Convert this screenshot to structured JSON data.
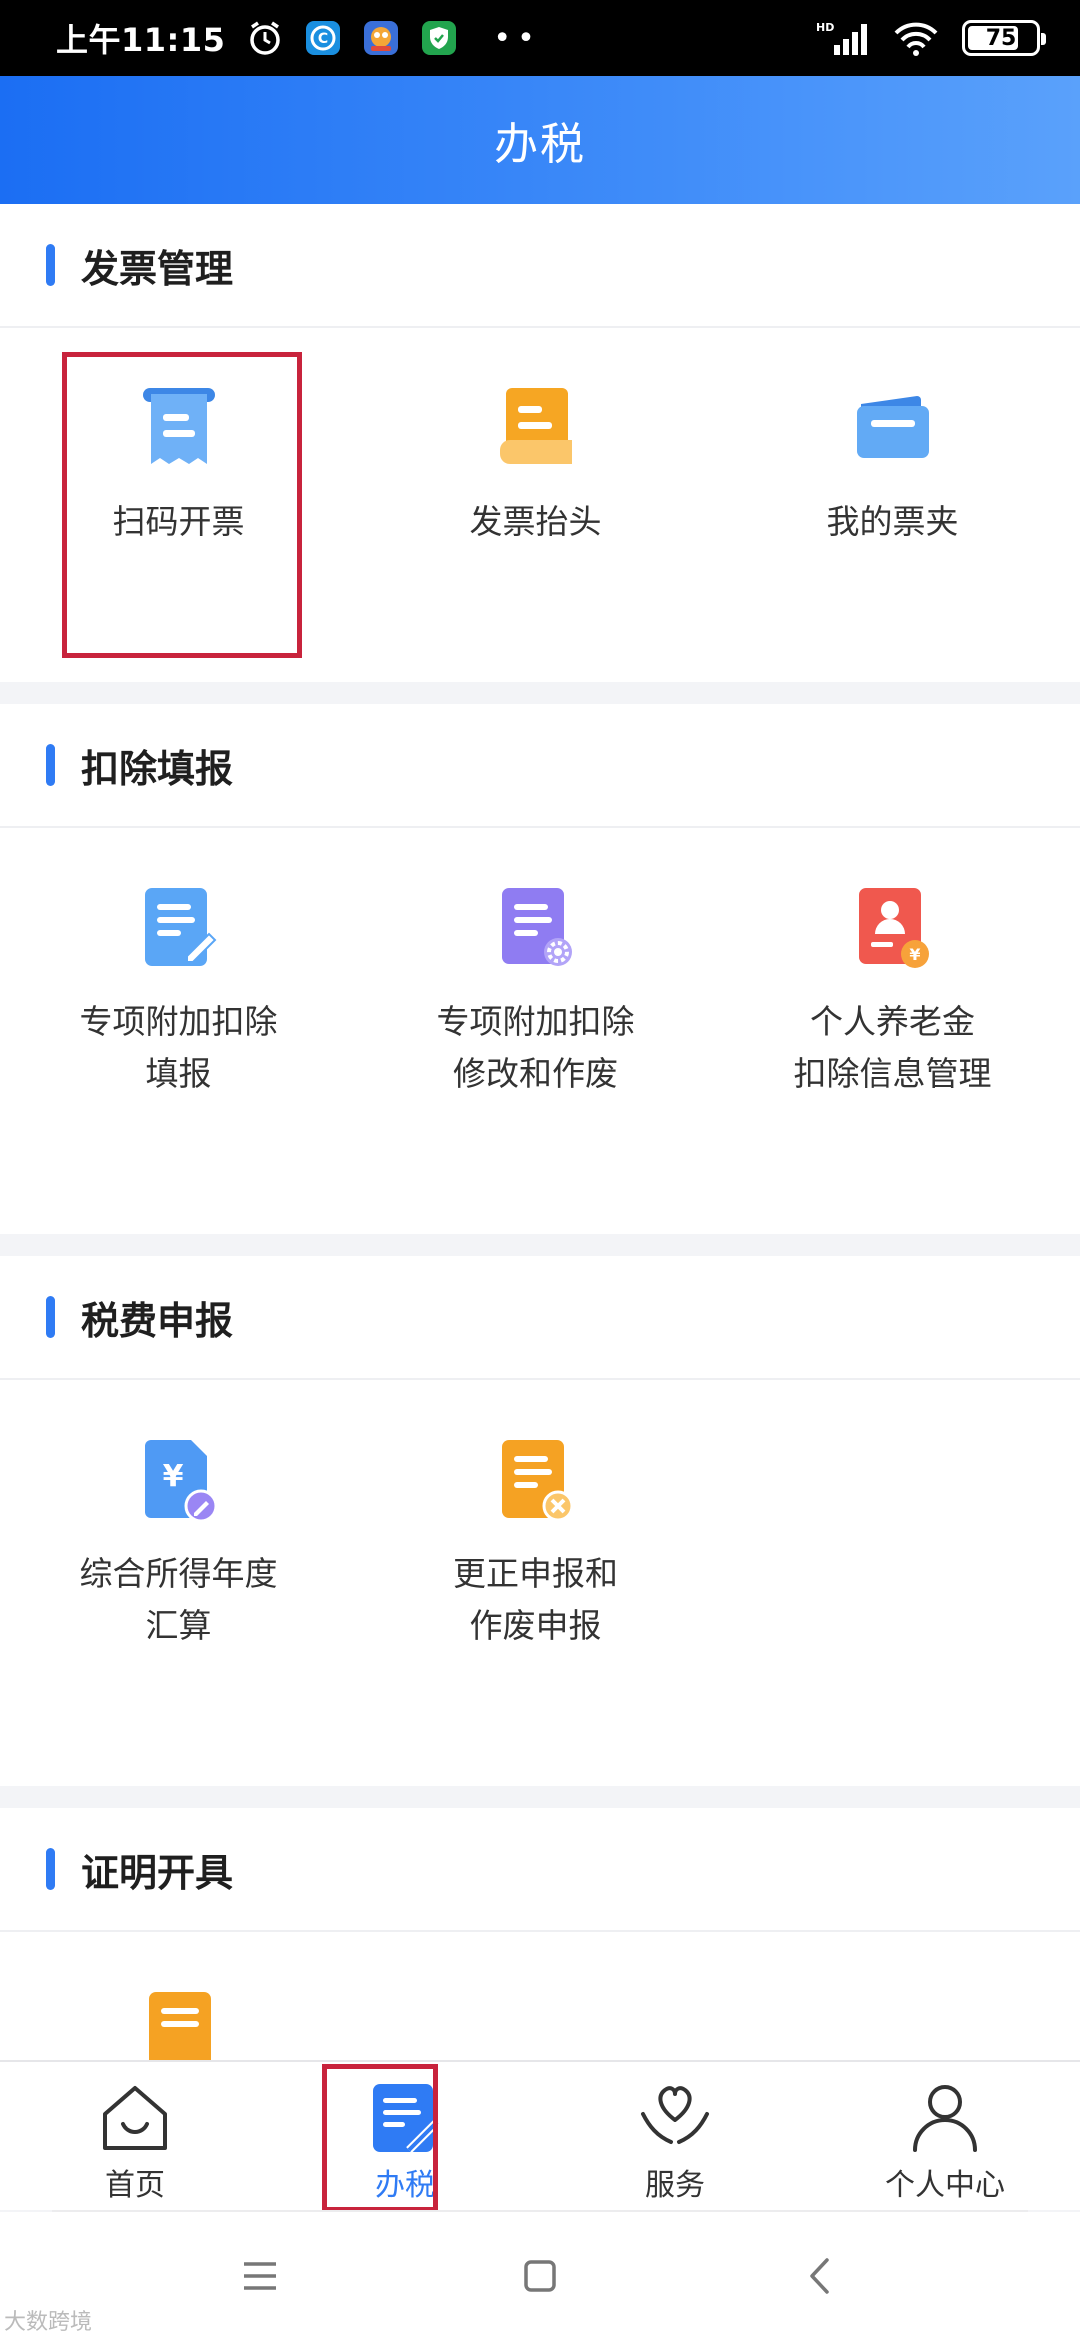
{
  "status_bar": {
    "time": "上午11:15",
    "network": "HD",
    "battery": "75",
    "battery_level": 0.75
  },
  "header": {
    "title": "办税"
  },
  "sections": [
    {
      "title": "发票管理",
      "items": [
        {
          "label": "扫码开票",
          "icon": "receipt-icon"
        },
        {
          "label": "发票抬头",
          "icon": "invoice-header-icon"
        },
        {
          "label": "我的票夹",
          "icon": "wallet-icon"
        }
      ]
    },
    {
      "title": "扣除填报",
      "items": [
        {
          "label": "专项附加扣除\n填报",
          "icon": "document-edit-icon"
        },
        {
          "label": "专项附加扣除\n修改和作废",
          "icon": "document-settings-icon"
        },
        {
          "label": "个人养老金\n扣除信息管理",
          "icon": "pension-card-icon"
        }
      ]
    },
    {
      "title": "税费申报",
      "items": [
        {
          "label": "综合所得年度\n汇算",
          "icon": "yuan-document-icon"
        },
        {
          "label": "更正申报和\n作废申报",
          "icon": "document-cancel-icon"
        }
      ]
    },
    {
      "title": "证明开具",
      "items": [
        {
          "label": "",
          "icon": "certificate-icon"
        }
      ]
    }
  ],
  "bottom_nav": [
    {
      "label": "首页",
      "icon": "home-icon",
      "active": false
    },
    {
      "label": "办税",
      "icon": "tax-document-icon",
      "active": true
    },
    {
      "label": "服务",
      "icon": "heart-hands-icon",
      "active": false
    },
    {
      "label": "个人中心",
      "icon": "person-icon",
      "active": false
    }
  ],
  "system_nav": [
    "menu-icon",
    "home-square-icon",
    "back-icon"
  ],
  "watermark": "大数跨境",
  "colors": {
    "accent": "#2f7bf4",
    "highlight": "#c8233c",
    "header_gradient_start": "#1b6ef3",
    "header_gradient_end": "#5aa1fb"
  }
}
